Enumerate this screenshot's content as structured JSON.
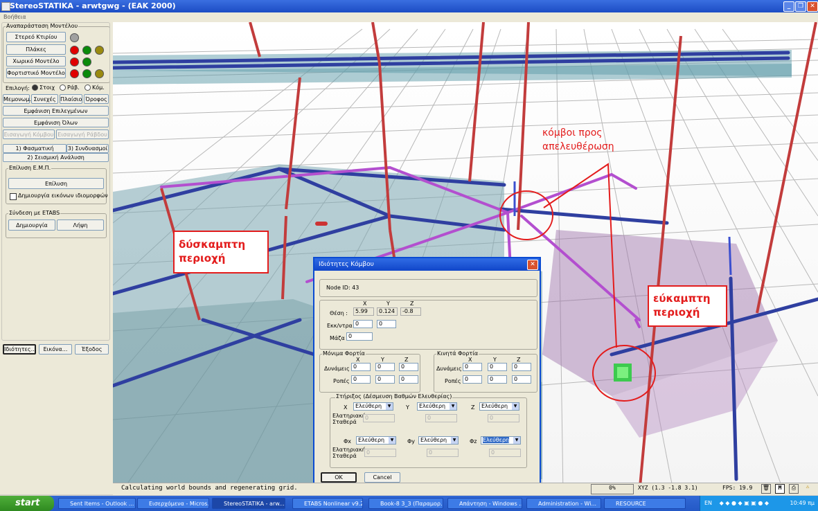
{
  "window": {
    "title": "StereoSTATIKA - arwtgwg - (EAK 2000)",
    "menu_help": "Βοήθεια"
  },
  "panel": {
    "model_group": "Αναπαράσταση Μοντέλου",
    "btn_solid": "Στερεό Κτιρίου",
    "btn_slabs": "Πλάκες",
    "btn_spatial": "Χωρικό Μοντέλο",
    "btn_load": "Φορτιστικό Μοντέλο",
    "selection_label": "Επιλογή:",
    "radio_elem": "Στοιχ",
    "radio_rod": "Ράβ.",
    "radio_node": "Κόμ.",
    "btn_isolated": "Μεμονωμ.",
    "btn_continuous": "Συνεχές",
    "btn_frame": "Πλαίσιο",
    "btn_floor": "Όροφος",
    "btn_show_selected": "Εμφάνιση Επιλεγμένων",
    "btn_show_all": "Εμφάνιση Όλων",
    "btn_insert_node": "Εισαγωγή Κόμβου",
    "btn_insert_rod": "Εισαγωγή Ράβδου",
    "analysis_1": "1) Φασματική Ανάλυση",
    "analysis_3": "3) Συνδυασμοί",
    "analysis_2": "2) Σεισμική Ανάλυση",
    "fem_group": "Επίλυση Ε.Μ.Π.",
    "btn_solve": "Επίλυση",
    "chk_images": "Δημιουργία εικόνων ιδιομορφών",
    "etabs_group": "Σύνδεση με ETABS",
    "btn_create": "Δημιουργία",
    "btn_receive": "Λήψη",
    "btn_props": "Ιδιότητες...",
    "btn_image": "Εικόνα...",
    "btn_exit": "Έξοδος"
  },
  "colors": {
    "red": "#e00000",
    "green": "#0a8a0a",
    "olive": "#9a8a10",
    "grey": "#a0a0a0"
  },
  "annotations": {
    "rigid": "δύσκαμπτη περιοχή",
    "flexible": "εύκαμπτη περιοχή",
    "nodes_line1": "κόμβοι προς",
    "nodes_line2": "απελευθέρωση"
  },
  "dialog": {
    "title": "Ιδιότητες Κόμβου",
    "node_id": "Node ID: 43",
    "col_x": "X",
    "col_y": "Y",
    "col_z": "Z",
    "pos_label": "Θέση :",
    "pos_x": "5.99",
    "pos_y": "0.124",
    "pos_z": "-0.8",
    "ecc_label": "Εκκ/ντρα :",
    "ecc_1": "0",
    "ecc_2": "0",
    "mass_label": "Μάζα :",
    "mass": "0",
    "perm_group": "Μόνιμα Φορτία",
    "live_group": "Κινητά Φορτία",
    "forces": "Δυνάμεις",
    "moments": "Ροπές",
    "zero": "0",
    "support_group": "Στήριξος (Δέσμευση Βαθμών Ελευθερίας)",
    "free": "Ελεύθερη",
    "spring": "Ελατηριακή Σταθερά",
    "phi_x": "Φx",
    "phi_y": "Φy",
    "phi_z": "Φz",
    "ok": "OK",
    "cancel": "Cancel"
  },
  "status": {
    "message": "Calculating world bounds and regenerating grid.",
    "percent": "0%",
    "xyz": "XYZ (1.3 -1.8 3.1)",
    "fps": "FPS: 19.9"
  },
  "taskbar": {
    "start": "start",
    "items": [
      "Sent Items - Outlook ...",
      "Εισερχόμενα - Micros...",
      "StereoSTATIKA - arw...",
      "ETABS Nonlinear v9.2...",
      "Book-8 3_3 (Παραμορ...",
      "Απάντηση - Windows ...",
      "Administration - Wi...",
      "RESOURCE"
    ],
    "lang": "EN",
    "clock": "10:49 πμ"
  }
}
